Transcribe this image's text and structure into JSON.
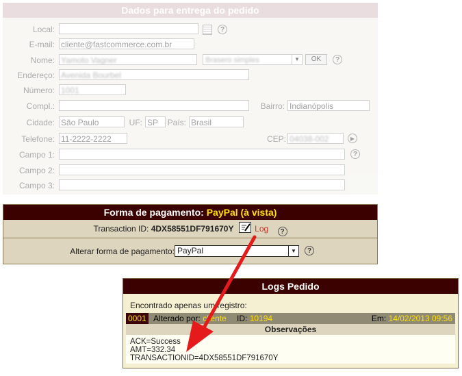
{
  "delivery": {
    "title": "Dados para entrega do pedido",
    "labels": {
      "local": "Local:",
      "email": "E-mail:",
      "nome": "Nome:",
      "endereco": "Endereço:",
      "numero": "Número:",
      "compl": "Compl.:",
      "bairro": "Bairro:",
      "cidade": "Cidade:",
      "uf": "UF:",
      "pais": "País:",
      "telefone": "Telefone:",
      "cep": "CEP:",
      "campo1": "Campo 1:",
      "campo2": "Campo 2:",
      "campo3": "Campo 3:"
    },
    "values": {
      "email": "cliente@fastcommerce.com.br",
      "nome": "Yamoto Vagner",
      "tipo": "Brasero simples",
      "endereco": "Avenida Bourbel",
      "numero": "1001",
      "bairro": "Indianópolis",
      "cidade": "São Paulo",
      "uf": "SP",
      "pais": "Brasil",
      "telefone": "11-2222-2222",
      "cep": "04038-002"
    },
    "ok_label": "OK"
  },
  "payment": {
    "title_prefix": "Forma de pagamento:",
    "method_title": "PayPal (à vista)",
    "transaction_label": "Transaction ID:",
    "transaction_id": "4DX58551DF791670Y",
    "log_link": "Log",
    "change_label": "Alterar forma de pagamento:",
    "selected_method": "PayPal"
  },
  "logs": {
    "title": "Logs Pedido",
    "found_text": "Encontrado apenas um registro:",
    "record": {
      "number": "0001",
      "status_prefix": "Alterado por:",
      "author": "cliente",
      "id_label": "ID:",
      "id_value": "10194",
      "date_label": "Em:",
      "date_value": "14/02/2013 09:56"
    },
    "observations_title": "Observações",
    "observation_lines": [
      "ACK=Success",
      "AMT=332.34",
      "TRANSACTIONID=4DX58551DF791670Y"
    ]
  },
  "colors": {
    "header_dark": "#3b0000",
    "highlight": "#ffe000",
    "arrow": "#e51b1b",
    "log_link": "#c0392b"
  },
  "icons": [
    "calendar-icon",
    "help-icon",
    "edit-log-icon",
    "play-icon",
    "select-arrow-icon"
  ]
}
